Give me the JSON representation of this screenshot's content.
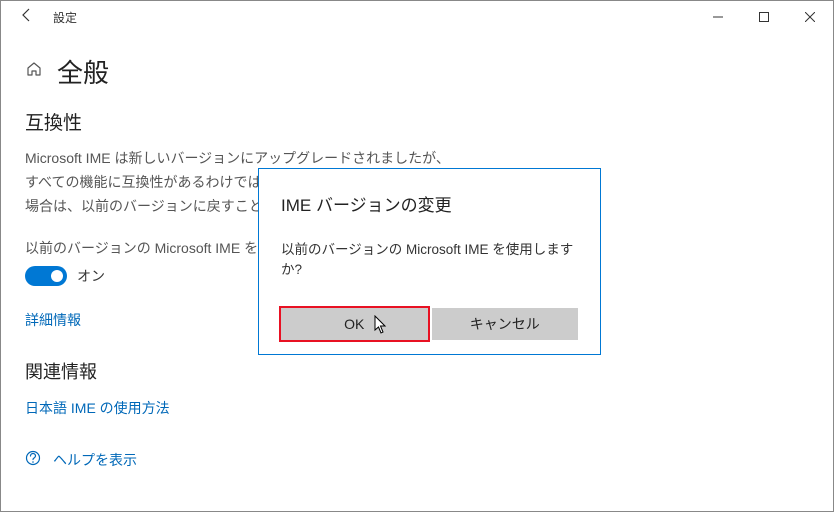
{
  "titlebar": {
    "title": "設定"
  },
  "page": {
    "title": "全般",
    "compat_heading": "互換性",
    "compat_desc": "Microsoft IME は新しいバージョンにアップグレードされましたが、すべての機能に互換性があるわけではありません。問題が発生した場合は、以前のバージョンに戻すことができます。",
    "toggle_label": "以前のバージョンの Microsoft IME を使用する",
    "toggle_state": "オン",
    "detail_link": "詳細情報",
    "related_heading": "関連情報",
    "related_link": "日本語 IME の使用方法",
    "help_text": "ヘルプを表示"
  },
  "dialog": {
    "title": "IME バージョンの変更",
    "message": "以前のバージョンの Microsoft IME を使用しますか?",
    "ok": "OK",
    "cancel": "キャンセル"
  }
}
